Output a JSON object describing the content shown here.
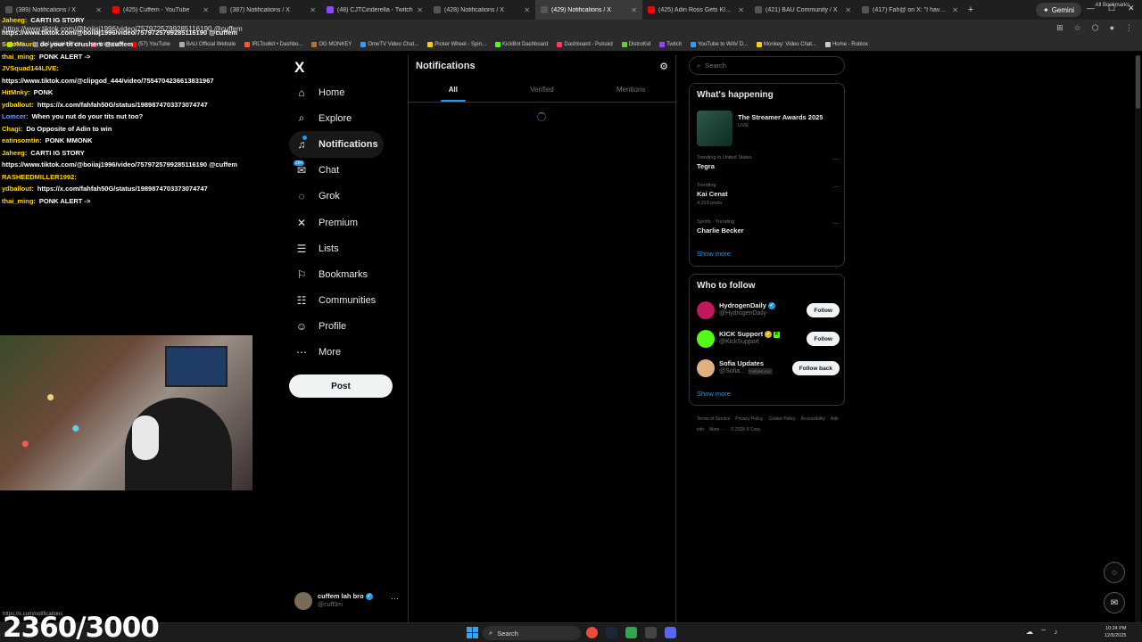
{
  "browser": {
    "tabs": [
      {
        "title": "(389) Notifications / X",
        "color": "#555555"
      },
      {
        "title": "(425) Cuffem - YouTube",
        "color": "#ff0000"
      },
      {
        "title": "(387) Notifications / X",
        "color": "#555555"
      },
      {
        "title": "(48) CJTCinderella - Twitch",
        "color": "#9146ff"
      },
      {
        "title": "(428) Notifications / X",
        "color": "#555555"
      },
      {
        "title": "(429) Notifications / X",
        "color": "#555555",
        "active": true
      },
      {
        "title": "(425) Adin Ross Gets KICKED O",
        "color": "#ff0000"
      },
      {
        "title": "(421) BAU Community / X",
        "color": "#555555"
      },
      {
        "title": "(417) Fah@ on X: \"I have boug",
        "color": "#555555"
      }
    ],
    "new_tab": "+",
    "gemini_label": "Gemini",
    "url": "https://www.tiktok.com/@boiiaj1996/video/7579725799285116190 @cuffem",
    "bookmarks": [
      {
        "label": "Kick",
        "color": "#53fc18"
      },
      {
        "label": "(1/4) Hamit Photo",
        "color": "#888888"
      },
      {
        "label": "Instagram",
        "color": "#e1306c"
      },
      {
        "label": "(57) YouTube",
        "color": "#ff0000"
      },
      {
        "label": "BAU Official Website",
        "color": "#aaaaaa"
      },
      {
        "label": "IRLToolkit • Dashbo...",
        "color": "#ff5533"
      },
      {
        "label": "OG MONKEY",
        "color": "#aa7733"
      },
      {
        "label": "OmeTV Video Chat...",
        "color": "#3399ff"
      },
      {
        "label": "Picker Wheel - Spin...",
        "color": "#ffcc00"
      },
      {
        "label": "KickBot Dashboard",
        "color": "#53fc18"
      },
      {
        "label": "Dashboard - Pulsoid",
        "color": "#ff3366"
      },
      {
        "label": "DistroKid",
        "color": "#66cc33"
      },
      {
        "label": "Twitch",
        "color": "#9146ff"
      },
      {
        "label": "YouTube to WAV D...",
        "color": "#3399ff"
      },
      {
        "label": "Monkey: Video Chat...",
        "color": "#ffcc00"
      },
      {
        "label": "Home - Roblox",
        "color": "#cccccc"
      }
    ],
    "all_bookmarks": "All Bookmarks",
    "status_url": "https://x.com/notifications"
  },
  "chat": [
    {
      "user": "Jaheeg:",
      "color": "#ffd700",
      "text": "CARTI IG STORY"
    },
    {
      "user": "",
      "color": "#ffffff",
      "text": "https://www.tiktok.com/@boiiaj1996/video/7579725799285116190 @cuffem"
    },
    {
      "user": "SoloMauri:",
      "color": "#ffd700",
      "text": "do your tit crushers @cuffem"
    },
    {
      "user": "thai_ming:",
      "color": "#ffd700",
      "text": "PONK ALERT ->"
    },
    {
      "user": "JVSquad144LIVE:",
      "color": "#ffd700",
      "text": ""
    },
    {
      "user": "",
      "color": "#ffffff",
      "text": "https://www.tiktok.com/@clipgod_444/video/7554704236613831967"
    },
    {
      "user": "HitMnky:",
      "color": "#ffd700",
      "text": "PONK"
    },
    {
      "user": "ydballout:",
      "color": "#ffd700",
      "text": "https://x.com/fahfah50G/status/1989874703373074747"
    },
    {
      "user": "Lomcer:",
      "color": "#6aa0ff",
      "text": "When you nut do your tits nut too?"
    },
    {
      "user": "Chagi:",
      "color": "#ffd700",
      "text": "Do Opposite of Adin to win"
    },
    {
      "user": "eatinsomtin:",
      "color": "#ffd700",
      "text": "PONK MMONK"
    },
    {
      "user": "Jaheeg:",
      "color": "#ffd700",
      "text": "CARTI IG STORY"
    },
    {
      "user": "",
      "color": "#ffffff",
      "text": "https://www.tiktok.com/@boiiaj1996/video/7579725799285116190 @cuffem"
    },
    {
      "user": "RASHEEDMILLER1992:",
      "color": "#ffd700",
      "text": ""
    },
    {
      "user": "ydballout:",
      "color": "#ffd700",
      "text": "https://x.com/fahfah50G/status/1989874703373074747"
    },
    {
      "user": "thai_ming:",
      "color": "#ffd700",
      "text": "PONK ALERT ->"
    }
  ],
  "counter": "2360/3000",
  "x_nav": {
    "logo": "X",
    "items": [
      {
        "label": "Home",
        "icon": "⌂"
      },
      {
        "label": "Explore",
        "icon": "⌕"
      },
      {
        "label": "Notifications",
        "icon": "♫",
        "active": true
      },
      {
        "label": "Chat",
        "icon": "✉",
        "badge": "20+"
      },
      {
        "label": "Grok",
        "icon": "◌"
      },
      {
        "label": "Premium",
        "icon": "✕"
      },
      {
        "label": "Lists",
        "icon": "☰"
      },
      {
        "label": "Bookmarks",
        "icon": "⚐"
      },
      {
        "label": "Communities",
        "icon": "☷"
      },
      {
        "label": "Profile",
        "icon": "☺"
      },
      {
        "label": "More",
        "icon": "⋯"
      }
    ],
    "post_label": "Post"
  },
  "account": {
    "name": "cuffem lah bro",
    "handle": "@cuff3m",
    "more": "···"
  },
  "main": {
    "title": "Notifications",
    "tabs": [
      "All",
      "Verified",
      "Mentions"
    ],
    "active_tab": "All"
  },
  "search": {
    "placeholder": "Search"
  },
  "happening": {
    "title": "What's happening",
    "live": {
      "name": "The Streamer Awards 2025",
      "tag": "LIVE"
    },
    "trends": [
      {
        "context": "Trending in United States",
        "name": "Tegra",
        "posts": ""
      },
      {
        "context": "Trending",
        "name": "Kai Cenat",
        "posts": "4,319 posts"
      },
      {
        "context": "Sports · Trending",
        "name": "Charlie Becker",
        "posts": ""
      }
    ],
    "show_more": "Show more"
  },
  "who_to_follow": {
    "title": "Who to follow",
    "accounts": [
      {
        "name": "HydrogenDaily",
        "handle": "@HydrogenDaily",
        "button": "Follow",
        "avatar_color": "#c2185b",
        "badge": "blue"
      },
      {
        "name": "KICK Support",
        "handle": "@KickSupport",
        "button": "Follow",
        "avatar_color": "#53fc18",
        "badge": "gold"
      },
      {
        "name": "Sofia Updates",
        "handle": "@Sofia...",
        "button": "Follow back",
        "avatar_color": "#e0b080",
        "follows_you": "Follows you"
      }
    ],
    "show_more": "Show more"
  },
  "footer": [
    "Terms of Service",
    "Privacy Policy",
    "Cookie Policy",
    "Accessibility",
    "Ads info",
    "More ···",
    "© 2025 X Corp."
  ],
  "taskbar": {
    "search": "Search",
    "time": "10:24 PM",
    "date": "12/6/2025"
  }
}
